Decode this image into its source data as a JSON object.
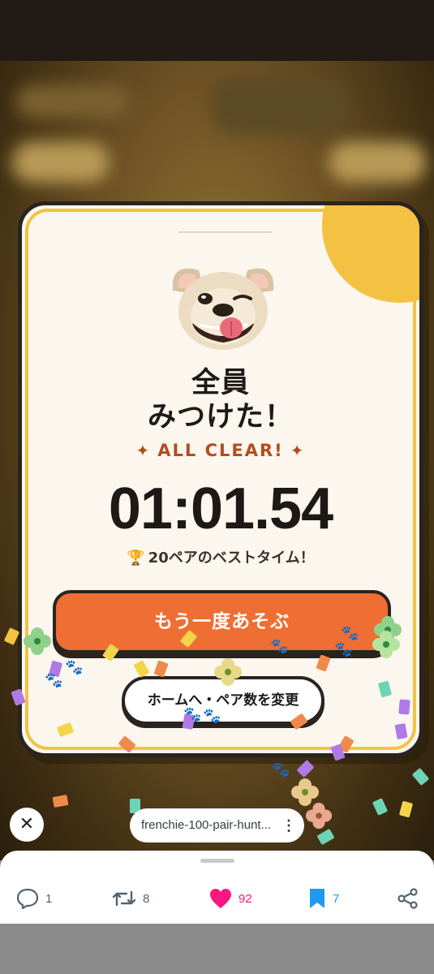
{
  "card": {
    "title_line1": "全員",
    "title_line2": "みつけた！",
    "subtitle": "ALL CLEAR!",
    "sparkle": "✦",
    "timer": "01:01.54",
    "best_icon": "🏆",
    "best_text": "20ペアのベストタイム！",
    "primary_button": "もう一度あそぶ",
    "secondary_button": "ホームへ・ペア数を変更"
  },
  "browser": {
    "close_icon": "✕",
    "url": "frenchie-100-pair-hunt...",
    "menu_icon": "⋮"
  },
  "actions": {
    "reply_count": "1",
    "repost_count": "8",
    "like_count": "92",
    "bookmark_count": "7"
  },
  "colors": {
    "accent_orange": "#ee6e33",
    "accent_yellow": "#f4c242",
    "like_pink": "#f91880",
    "bookmark_blue": "#1d9bf0"
  }
}
